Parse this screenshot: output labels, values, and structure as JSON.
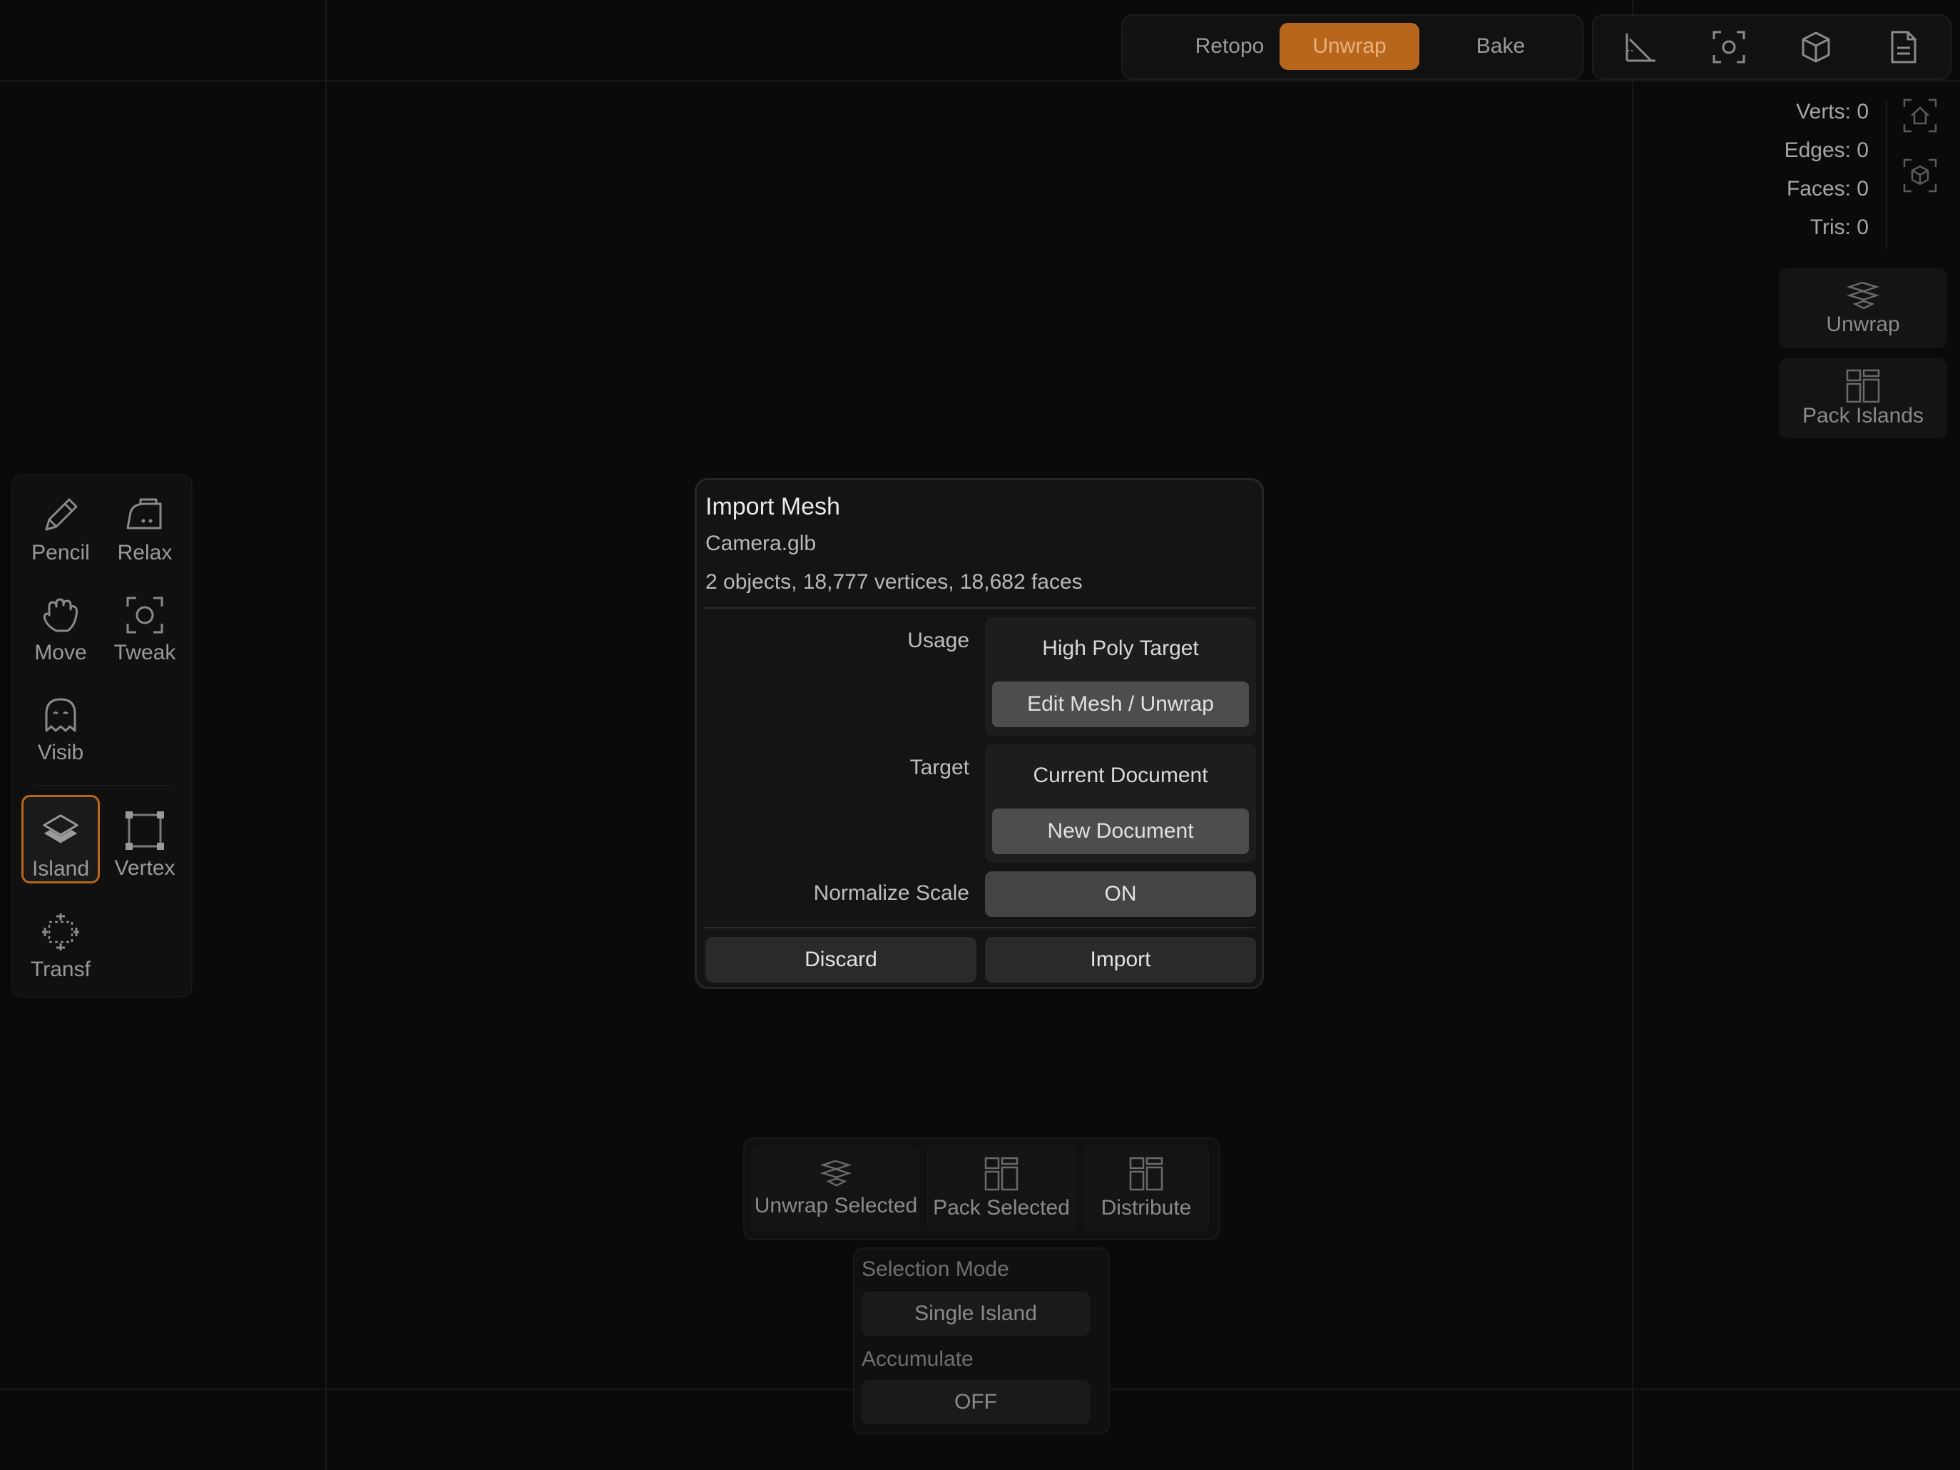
{
  "modes": [
    {
      "label": "Retopo",
      "active": false
    },
    {
      "label": "Unwrap",
      "active": true
    },
    {
      "label": "Bake",
      "active": false
    }
  ],
  "top_icons": [
    "angle-icon",
    "frame-focus-icon",
    "cube-icon",
    "document-icon"
  ],
  "stats": {
    "verts": "Verts: 0",
    "edges": "Edges: 0",
    "faces": "Faces: 0",
    "tris": "Tris: 0"
  },
  "right_panel": {
    "unwrap_label": "Unwrap",
    "pack_label": "Pack Islands"
  },
  "tools": {
    "pencil": "Pencil",
    "relax": "Relax",
    "move": "Move",
    "tweak": "Tweak",
    "visib": "Visib",
    "island": "Island",
    "vertex": "Vertex",
    "transf": "Transf"
  },
  "dialog": {
    "title": "Import Mesh",
    "filename": "Camera.glb",
    "summary": "2 objects, 18,777 vertices, 18,682 faces",
    "usage_label": "Usage",
    "usage_options": [
      "High Poly Target",
      "Edit Mesh / Unwrap"
    ],
    "usage_selected": "Edit Mesh / Unwrap",
    "target_label": "Target",
    "target_options": [
      "Current Document",
      "New Document"
    ],
    "target_selected": "New Document",
    "normalize_label": "Normalize Scale",
    "normalize_value": "ON",
    "discard_label": "Discard",
    "import_label": "Import"
  },
  "actions": {
    "unwrap_selected": "Unwrap Selected",
    "pack_selected": "Pack Selected",
    "distribute": "Distribute"
  },
  "selection": {
    "mode_label": "Selection Mode",
    "mode_value": "Single Island",
    "accumulate_label": "Accumulate",
    "accumulate_value": "OFF"
  },
  "colors": {
    "accent": "#b8661c",
    "background": "#0a0a0a"
  }
}
